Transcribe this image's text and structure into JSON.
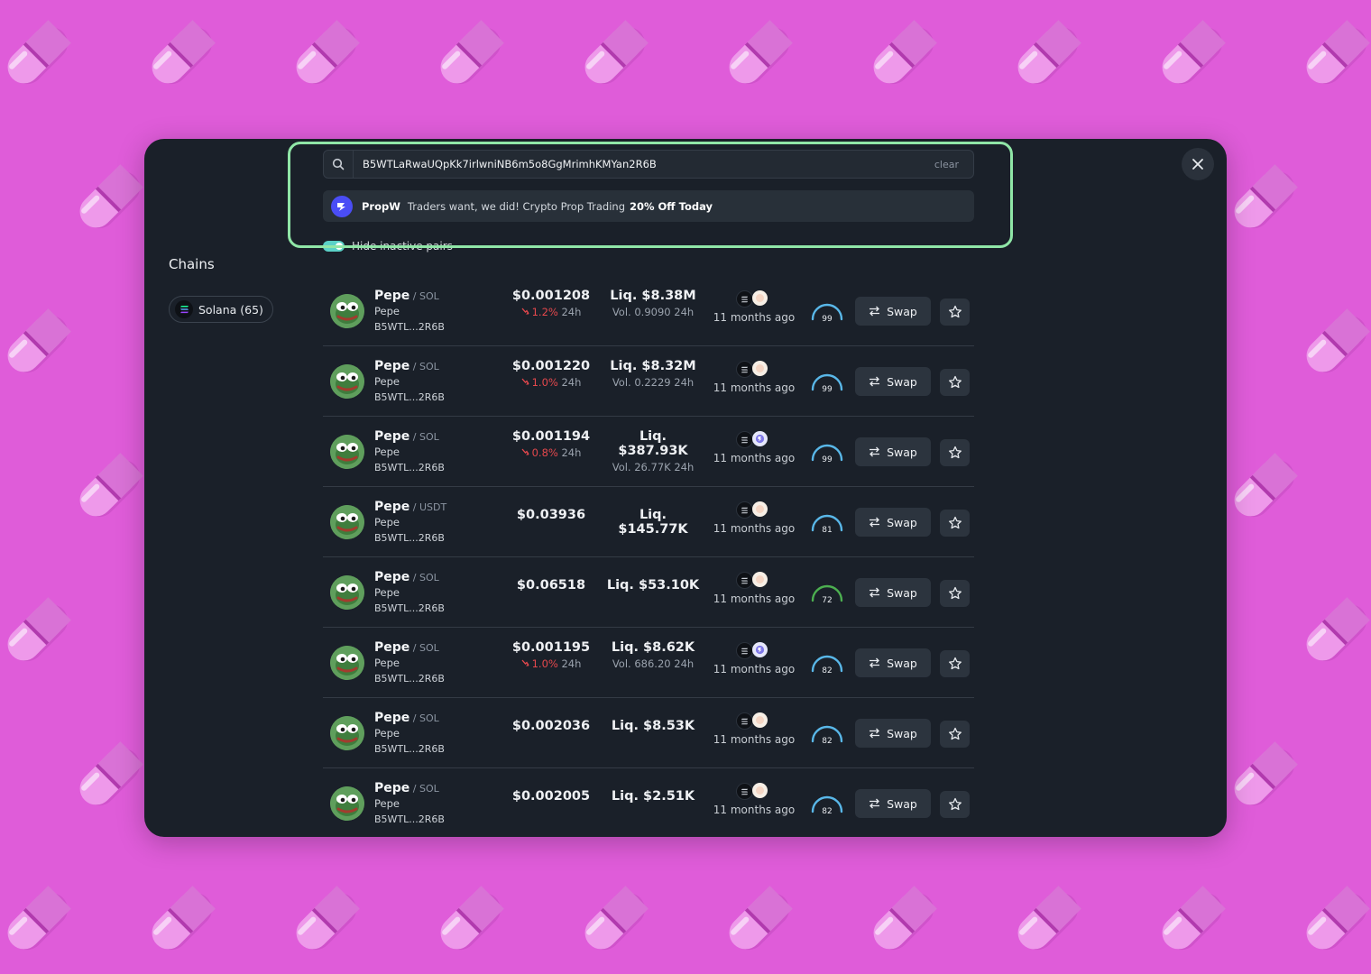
{
  "search": {
    "value": "B5WTLaRwaUQpKk7irlwniNB6m5o8GgMrimhKMYan2R6B",
    "clear_label": "clear"
  },
  "ad": {
    "name": "PropW",
    "text": "Traders want, we did! Crypto Prop Trading",
    "highlight": "20% Off Today"
  },
  "filter": {
    "label": "Hide inactive pairs",
    "enabled": true
  },
  "sidebar": {
    "title": "Chains",
    "chains": [
      {
        "label": "Solana (65)"
      }
    ]
  },
  "colors": {
    "background": "#df5cd9",
    "modal": "#1a2029",
    "highlight": "#90e6a7",
    "negative": "#e5484d",
    "score_blue": "#59b7e8",
    "score_green": "#4caf50"
  },
  "results": [
    {
      "symbol": "Pepe",
      "quote": "SOL",
      "name": "Pepe",
      "address": "B5WTL...2R6B",
      "price": "$0.001208",
      "change": "1.2%",
      "change_period": "24h",
      "liquidity": "Liq. $8.38M",
      "volume": "Vol. 0.9090",
      "volume_period": "24h",
      "dex": "raydium",
      "age": "11 months ago",
      "score": "99",
      "score_color": "blue",
      "swap_label": "Swap"
    },
    {
      "symbol": "Pepe",
      "quote": "SOL",
      "name": "Pepe",
      "address": "B5WTL...2R6B",
      "price": "$0.001220",
      "change": "1.0%",
      "change_period": "24h",
      "liquidity": "Liq. $8.32M",
      "volume": "Vol. 0.2229",
      "volume_period": "24h",
      "dex": "raydium",
      "age": "11 months ago",
      "score": "99",
      "score_color": "blue",
      "swap_label": "Swap"
    },
    {
      "symbol": "Pepe",
      "quote": "SOL",
      "name": "Pepe",
      "address": "B5WTL...2R6B",
      "price": "$0.001194",
      "change": "0.8%",
      "change_period": "24h",
      "liquidity": "Liq. $387.93K",
      "volume": "Vol. 26.77K",
      "volume_period": "24h",
      "dex": "orca",
      "age": "11 months ago",
      "score": "99",
      "score_color": "blue",
      "swap_label": "Swap"
    },
    {
      "symbol": "Pepe",
      "quote": "USDT",
      "name": "Pepe",
      "address": "B5WTL...2R6B",
      "price": "$0.03936",
      "change": "",
      "change_period": "",
      "liquidity": "Liq. $145.77K",
      "volume": "",
      "volume_period": "",
      "dex": "raydium",
      "age": "11 months ago",
      "score": "81",
      "score_color": "blue",
      "swap_label": "Swap"
    },
    {
      "symbol": "Pepe",
      "quote": "SOL",
      "name": "Pepe",
      "address": "B5WTL...2R6B",
      "price": "$0.06518",
      "change": "",
      "change_period": "",
      "liquidity": "Liq. $53.10K",
      "volume": "",
      "volume_period": "",
      "dex": "raydium",
      "age": "11 months ago",
      "score": "72",
      "score_color": "green",
      "swap_label": "Swap"
    },
    {
      "symbol": "Pepe",
      "quote": "SOL",
      "name": "Pepe",
      "address": "B5WTL...2R6B",
      "price": "$0.001195",
      "change": "1.0%",
      "change_period": "24h",
      "liquidity": "Liq. $8.62K",
      "volume": "Vol. 686.20",
      "volume_period": "24h",
      "dex": "orca",
      "age": "11 months ago",
      "score": "82",
      "score_color": "blue",
      "swap_label": "Swap"
    },
    {
      "symbol": "Pepe",
      "quote": "SOL",
      "name": "Pepe",
      "address": "B5WTL...2R6B",
      "price": "$0.002036",
      "change": "",
      "change_period": "",
      "liquidity": "Liq. $8.53K",
      "volume": "",
      "volume_period": "",
      "dex": "raydium",
      "age": "11 months ago",
      "score": "82",
      "score_color": "blue",
      "swap_label": "Swap"
    },
    {
      "symbol": "Pepe",
      "quote": "SOL",
      "name": "Pepe",
      "address": "B5WTL...2R6B",
      "price": "$0.002005",
      "change": "",
      "change_period": "",
      "liquidity": "Liq. $2.51K",
      "volume": "",
      "volume_period": "",
      "dex": "raydium",
      "age": "11 months ago",
      "score": "82",
      "score_color": "blue",
      "swap_label": "Swap"
    }
  ]
}
